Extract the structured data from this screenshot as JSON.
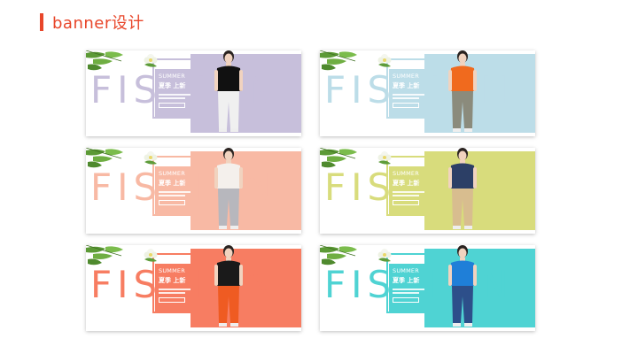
{
  "header": {
    "title": "banner设计"
  },
  "banner_text": {
    "big_word": "FISHION",
    "season": "SUMMER",
    "headline": "夏季 上新"
  },
  "banners": [
    {
      "id": "purple",
      "color": "#c7bfdb",
      "shirt": "#111111",
      "pants": "#f0f0f0"
    },
    {
      "id": "blue",
      "color": "#bcdde8",
      "shirt": "#f06a1e",
      "pants": "#8b8b7c"
    },
    {
      "id": "peach",
      "color": "#f8b9a4",
      "shirt": "#f4f0ec",
      "pants": "#b7b7bd"
    },
    {
      "id": "lime",
      "color": "#d8dc7c",
      "shirt": "#2c3f66",
      "pants": "#d8bd8f"
    },
    {
      "id": "coral",
      "color": "#f77d62",
      "shirt": "#1a1a1a",
      "pants": "#ef5b22"
    },
    {
      "id": "teal",
      "color": "#4fd3d3",
      "shirt": "#1f7fd8",
      "pants": "#2d4f8a"
    }
  ]
}
